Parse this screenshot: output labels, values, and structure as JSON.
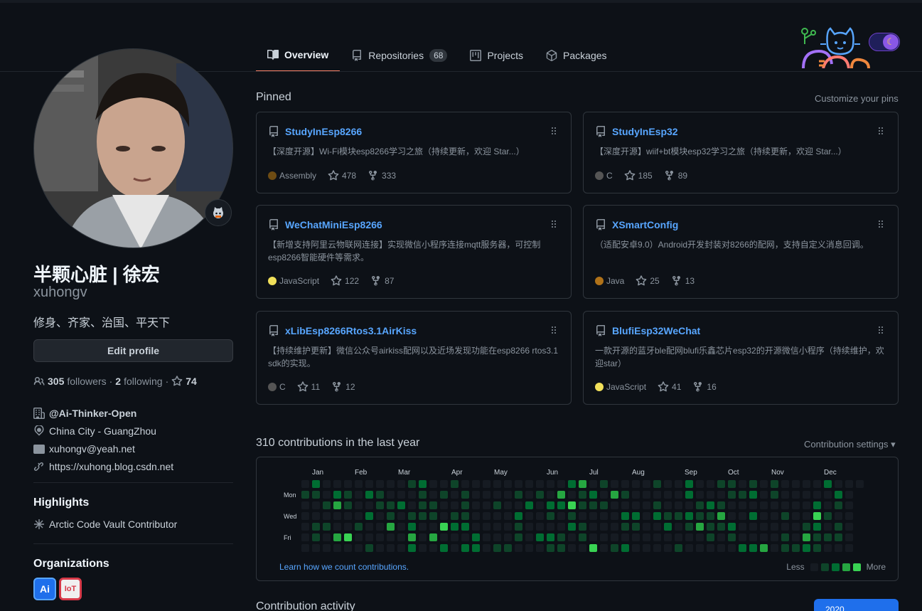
{
  "tabs": [
    {
      "label": "Overview",
      "icon": "book-icon"
    },
    {
      "label": "Repositories",
      "count": "68",
      "icon": "repo-icon"
    },
    {
      "label": "Projects",
      "icon": "project-icon"
    },
    {
      "label": "Packages",
      "icon": "package-icon"
    }
  ],
  "profile": {
    "fullname": "半颗心脏 | 徐宏",
    "username": "xuhongv",
    "bio": "修身、齐家、治国、平天下",
    "edit_label": "Edit profile",
    "followers_count": "305",
    "followers_label": "followers",
    "following_count": "2",
    "following_label": "following",
    "stars_count": "74",
    "org": "@Ai-Thinker-Open",
    "location": "China City - GuangZhou",
    "email": "xuhongv@yeah.net",
    "website": "https://xuhong.blog.csdn.net",
    "highlights_title": "Highlights",
    "highlight": "Arctic Code Vault Contributor",
    "orgs_title": "Organizations",
    "org_avatars": [
      "Ai",
      "IoT"
    ]
  },
  "pinned": {
    "title": "Pinned",
    "customize": "Customize your pins",
    "repos": [
      {
        "name": "StudyInEsp8266",
        "desc": "【深度开源】Wi-Fi模块esp8266学习之旅（持续更新，欢迎 Star...）",
        "lang": "Assembly",
        "lang_color": "#6E4C13",
        "stars": "478",
        "forks": "333"
      },
      {
        "name": "StudyInEsp32",
        "desc": "【深度开源】wiif+bt模块esp32学习之旅（持续更新，欢迎 Star...）",
        "lang": "C",
        "lang_color": "#555555",
        "stars": "185",
        "forks": "89"
      },
      {
        "name": "WeChatMiniEsp8266",
        "desc": "【新增支持阿里云物联网连接】实现微信小程序连接mqtt服务器，可控制esp8266智能硬件等需求。",
        "lang": "JavaScript",
        "lang_color": "#f1e05a",
        "stars": "122",
        "forks": "87"
      },
      {
        "name": "XSmartConfig",
        "desc": "（适配安卓9.0）Android开发封装对8266的配网，支持自定义消息回调。",
        "lang": "Java",
        "lang_color": "#b07219",
        "stars": "25",
        "forks": "13"
      },
      {
        "name": "xLibEsp8266Rtos3.1AirKiss",
        "desc": "【持续维护更新】微信公众号airkiss配网以及近场发现功能在esp8266 rtos3.1 sdk的实现。",
        "lang": "C",
        "lang_color": "#555555",
        "stars": "11",
        "forks": "12"
      },
      {
        "name": "BlufiEsp32WeChat",
        "desc": "一款开源的蓝牙ble配网blufi乐鑫芯片esp32的开源微信小程序（持续维护，欢迎star）",
        "lang": "JavaScript",
        "lang_color": "#f1e05a",
        "stars": "41",
        "forks": "16"
      }
    ]
  },
  "contributions": {
    "title": "310 contributions in the last year",
    "settings": "Contribution settings ▾",
    "months": [
      "Jan",
      "Feb",
      "Mar",
      "Apr",
      "May",
      "Jun",
      "Jul",
      "Aug",
      "Sep",
      "Oct",
      "Nov",
      "Dec"
    ],
    "days": [
      "Mon",
      "Wed",
      "Fri"
    ],
    "learn": "Learn how we count contributions.",
    "less": "Less",
    "more": "More",
    "colors": [
      "#161b22",
      "#0e4429",
      "#006d32",
      "#26a641",
      "#39d353"
    ]
  },
  "activity": {
    "title": "Contribution activity",
    "year": "2020"
  }
}
